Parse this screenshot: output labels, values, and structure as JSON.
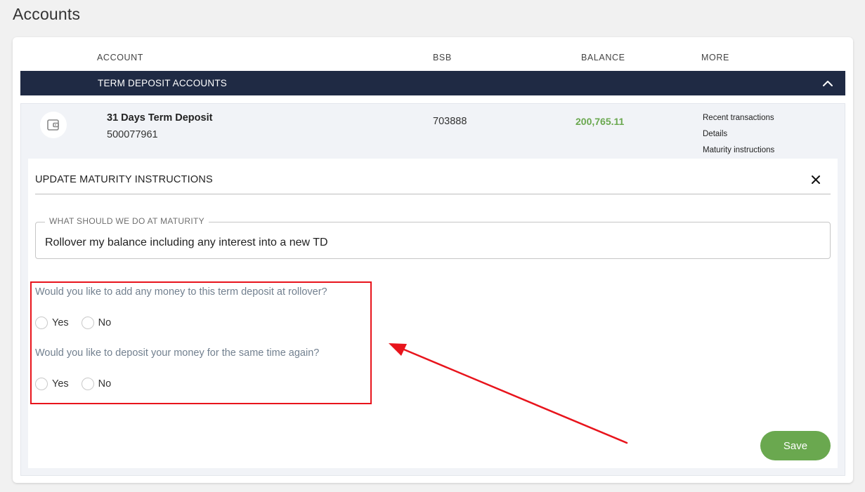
{
  "page": {
    "title": "Accounts"
  },
  "table": {
    "headers": {
      "account": "ACCOUNT",
      "bsb": "BSB",
      "balance": "BALANCE",
      "more": "MORE"
    },
    "section": {
      "label": "TERM DEPOSIT ACCOUNTS"
    },
    "account": {
      "name": "31 Days Term Deposit",
      "number": "500077961",
      "bsb": "703888",
      "balance": "200,765.11",
      "links": [
        "Recent transactions",
        "Details",
        "Maturity instructions"
      ]
    }
  },
  "maturity_panel": {
    "title": "UPDATE MATURITY INSTRUCTIONS",
    "field": {
      "legend": "WHAT SHOULD WE DO AT MATURITY",
      "value": "Rollover my balance including any interest into a new TD"
    },
    "questions": [
      {
        "text": "Would you like to add any money to this term deposit at rollover?",
        "options": [
          "Yes",
          "No"
        ]
      },
      {
        "text": "Would you like to deposit your money for the same time again?",
        "options": [
          "Yes",
          "No"
        ]
      }
    ],
    "save_label": "Save"
  },
  "colors": {
    "section_bar": "#1f2a44",
    "balance": "#6aa84f",
    "save_button": "#6aa84f",
    "annotation": "#e8141c"
  },
  "icons": {
    "section_toggle": "chevron-up-icon",
    "account": "wallet-icon",
    "close": "close-icon"
  }
}
